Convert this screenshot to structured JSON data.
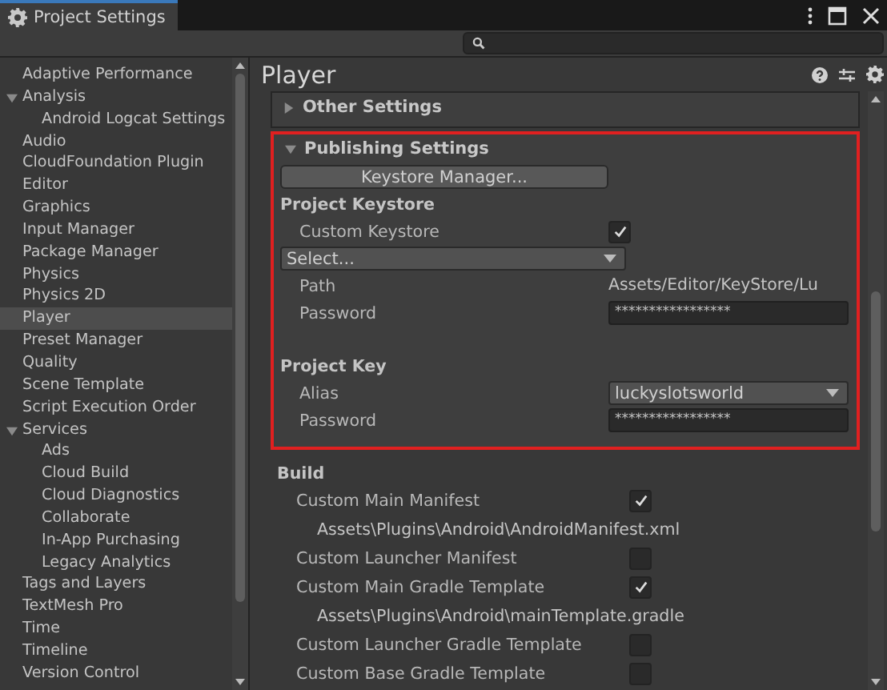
{
  "window": {
    "title": "Project Settings"
  },
  "sidebar": {
    "items": [
      {
        "label": "Adaptive Performance",
        "selected": false
      },
      {
        "label": "Analysis",
        "selected": false,
        "expanded": true,
        "children": [
          {
            "label": "Android Logcat Settings",
            "selected": false
          }
        ]
      },
      {
        "label": "Audio",
        "selected": false
      },
      {
        "label": "CloudFoundation Plugin",
        "selected": false
      },
      {
        "label": "Editor",
        "selected": false
      },
      {
        "label": "Graphics",
        "selected": false
      },
      {
        "label": "Input Manager",
        "selected": false
      },
      {
        "label": "Package Manager",
        "selected": false
      },
      {
        "label": "Physics",
        "selected": false
      },
      {
        "label": "Physics 2D",
        "selected": false
      },
      {
        "label": "Player",
        "selected": true
      },
      {
        "label": "Preset Manager",
        "selected": false
      },
      {
        "label": "Quality",
        "selected": false
      },
      {
        "label": "Scene Template",
        "selected": false
      },
      {
        "label": "Script Execution Order",
        "selected": false
      },
      {
        "label": "Services",
        "selected": false,
        "expanded": true,
        "children": [
          {
            "label": "Ads",
            "selected": false
          },
          {
            "label": "Cloud Build",
            "selected": false
          },
          {
            "label": "Cloud Diagnostics",
            "selected": false
          },
          {
            "label": "Collaborate",
            "selected": false
          },
          {
            "label": "In-App Purchasing",
            "selected": false
          },
          {
            "label": "Legacy Analytics",
            "selected": false
          }
        ]
      },
      {
        "label": "Tags and Layers",
        "selected": false
      },
      {
        "label": "TextMesh Pro",
        "selected": false
      },
      {
        "label": "Time",
        "selected": false
      },
      {
        "label": "Timeline",
        "selected": false
      },
      {
        "label": "Version Control",
        "selected": false
      }
    ]
  },
  "inspector": {
    "title": "Player",
    "foldouts": [
      {
        "label": "Other Settings",
        "expanded": false,
        "highlighted": false
      },
      {
        "label": "Publishing Settings",
        "expanded": true,
        "highlighted": true,
        "button": "Keystore Manager...",
        "groups": [
          {
            "heading": "Project Keystore",
            "rows": [
              {
                "kind": "toggle",
                "label": "Custom Keystore",
                "checked": true
              },
              {
                "kind": "dropdown",
                "value": "Select..."
              },
              {
                "kind": "text",
                "label": "Path",
                "value": "Assets/Editor/KeyStore/Lu"
              },
              {
                "kind": "password",
                "label": "Password",
                "value": "*****************"
              }
            ]
          },
          {
            "heading": "Project Key",
            "rows": [
              {
                "kind": "dropdown",
                "label": "Alias",
                "value": "luckyslotsworld"
              },
              {
                "kind": "password",
                "label": "Password",
                "value": "*****************"
              }
            ]
          }
        ]
      }
    ],
    "after": [
      {
        "heading": "Build",
        "rows": [
          {
            "kind": "toggle",
            "label": "Custom Main Manifest",
            "checked": true
          },
          {
            "kind": "path",
            "value": "Assets\\Plugins\\Android\\AndroidManifest.xml"
          },
          {
            "kind": "toggle",
            "label": "Custom Launcher Manifest",
            "checked": false
          },
          {
            "kind": "toggle",
            "label": "Custom Main Gradle Template",
            "checked": true
          },
          {
            "kind": "path",
            "value": "Assets\\Plugins\\Android\\mainTemplate.gradle"
          },
          {
            "kind": "toggle",
            "label": "Custom Launcher Gradle Template",
            "checked": false
          },
          {
            "kind": "toggle",
            "label": "Custom Base Gradle Template",
            "checked": false
          }
        ]
      }
    ]
  }
}
